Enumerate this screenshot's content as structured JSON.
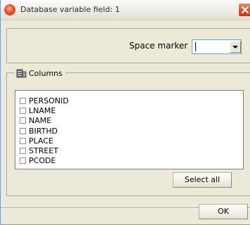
{
  "window": {
    "title": "Database variable field: 1"
  },
  "space_marker": {
    "label": "Space marker",
    "value": ""
  },
  "columns": {
    "legend": "Columns",
    "items": [
      {
        "label": "PERSONID",
        "checked": false
      },
      {
        "label": "LNAME",
        "checked": false
      },
      {
        "label": "NAME",
        "checked": false
      },
      {
        "label": "BIRTHD",
        "checked": false
      },
      {
        "label": "PLACE",
        "checked": false
      },
      {
        "label": "STREET",
        "checked": false
      },
      {
        "label": "PCODE",
        "checked": false
      }
    ]
  },
  "buttons": {
    "select_all": "Select all",
    "ok": "OK"
  },
  "icons": {
    "app": "app-icon",
    "close": "close-icon",
    "dropdown": "chevron-down-icon",
    "columns": "database-icon"
  },
  "colors": {
    "close_button": "#d6502a",
    "window_bg": "#ece9d8",
    "list_bg": "#ffffff"
  }
}
